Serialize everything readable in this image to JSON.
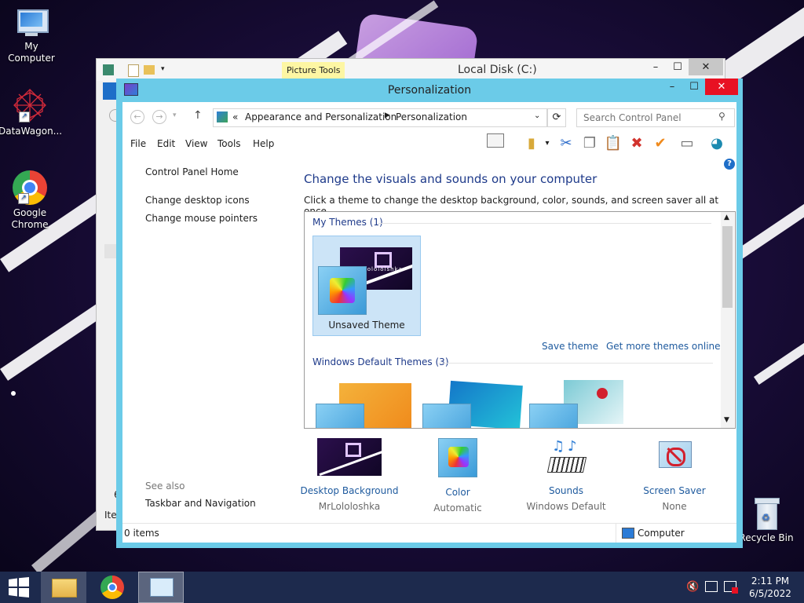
{
  "desktop": {
    "icons": [
      {
        "label": "My Computer"
      },
      {
        "label": "DataWagon..."
      },
      {
        "label": "Google Chrome"
      },
      {
        "label": "Recycle Bin"
      }
    ]
  },
  "background_window": {
    "title": "Local Disk (C:)",
    "ribbon_tab": "Picture Tools",
    "partial_left_text": "6",
    "partial_bottom_text": "Iter"
  },
  "window": {
    "title": "Personalization",
    "address": {
      "sep": "«",
      "crumbs": [
        "Appearance and Personalization",
        "Personalization"
      ]
    },
    "search_placeholder": "Search Control Panel",
    "menu": [
      "File",
      "Edit",
      "View",
      "Tools",
      "Help"
    ],
    "left_nav": {
      "home": "Control Panel Home",
      "links": [
        "Change desktop icons",
        "Change mouse pointers"
      ],
      "see_also_label": "See also",
      "see_also_links": [
        "Taskbar and Navigation"
      ]
    },
    "main": {
      "heading": "Change the visuals and sounds on your computer",
      "subtext": "Click a theme to change the desktop background, color, sounds, and screen saver all at once.",
      "my_themes": "My Themes (1)",
      "unsaved_theme": "Unsaved Theme",
      "save_theme": "Save theme",
      "get_more": "Get more themes online",
      "default_themes": "Windows Default Themes (3)",
      "thumb_text": "Lolololshka"
    },
    "bottom": [
      {
        "label": "Desktop Background",
        "value": "MrLololoshka"
      },
      {
        "label": "Color",
        "value": "Automatic"
      },
      {
        "label": "Sounds",
        "value": "Windows Default"
      },
      {
        "label": "Screen Saver",
        "value": "None"
      }
    ],
    "status": {
      "items": "0 items",
      "computer": "Computer"
    }
  },
  "taskbar": {
    "time": "2:11 PM",
    "date": "6/5/2022"
  },
  "colors": {
    "accent": "#6bcbe8",
    "link": "#1e5a9e",
    "heading": "#1e3a8a",
    "close_red": "#e81123"
  }
}
